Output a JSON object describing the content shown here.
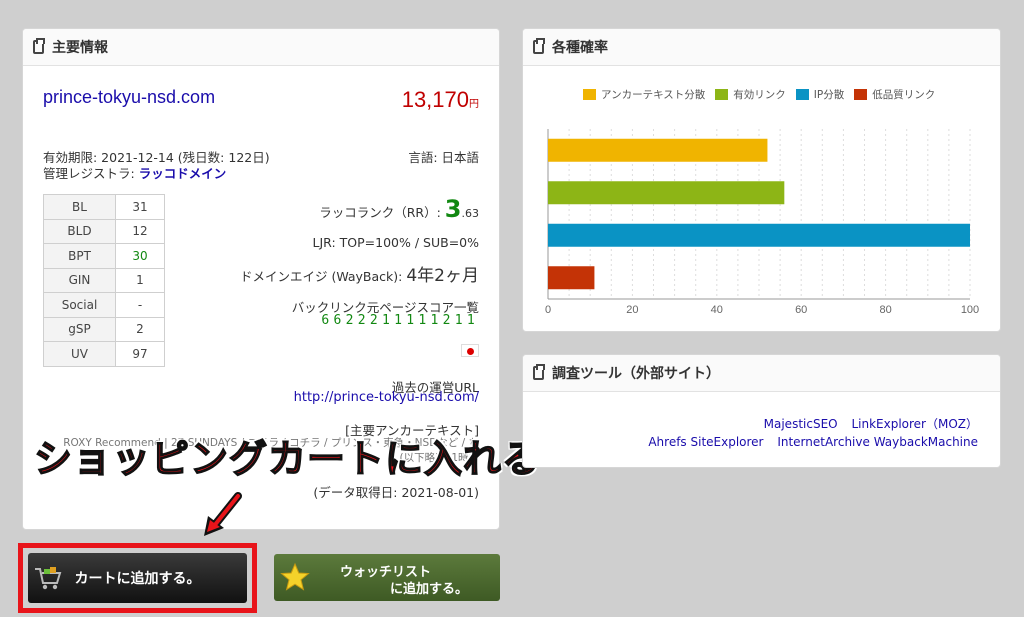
{
  "main": {
    "header": "主要情報",
    "domain": "prince-tokyu-nsd.com",
    "price": "13,170",
    "price_unit": "円",
    "expire": "有効期限: 2021-12-14 (残日数: 122日)",
    "registrar_label": "管理レジストラ: ",
    "registrar": "ラッコドメイン",
    "language": "言語: 日本語",
    "metrics": [
      {
        "key": "BL",
        "value": "31"
      },
      {
        "key": "BLD",
        "value": "12"
      },
      {
        "key": "BPT",
        "value": "30"
      },
      {
        "key": "GIN",
        "value": "1"
      },
      {
        "key": "Social",
        "value": "-"
      },
      {
        "key": "gSP",
        "value": "2"
      },
      {
        "key": "UV",
        "value": "97"
      }
    ],
    "rr_label": "ラッコランク（RR）:",
    "rr_big": "3",
    "rr_small": ".63",
    "ljr": "LJR: TOP=100% / SUB=0%",
    "age_label": "ドメインエイジ (WayBack):",
    "age_value": "4年2ヶ月",
    "backlink_title": "バックリンク元ページスコア一覧",
    "backlink_scores": "6622211111211",
    "past_label": "過去の運営URL",
    "past_url": "http://prince-tokyu-nsd.com/",
    "anchor_label": "[主要アンカーテキスト]",
    "anchor_line1": "ROXY Recommend | 27 SUNDAYS / コチラ / コチラ / プリンス・東急・NSDなど / ち",
    "anchor_line2": "…(以下略)  ×1時間",
    "fetch_date": "(データ取得日: 2021-08-01)"
  },
  "overlay": {
    "caption": "ショッピングカートに入れる"
  },
  "buttons": {
    "cart": "カートに追加する。",
    "watch_line1": "ウォッチリスト",
    "watch_line2": "に追加する。"
  },
  "prob": {
    "header": "各種確率"
  },
  "chart_data": {
    "type": "bar",
    "orientation": "horizontal",
    "series": [
      {
        "name": "アンカーテキスト分散",
        "value": 52,
        "color": "#f0b400"
      },
      {
        "name": "有効リンク",
        "value": 56,
        "color": "#8db516"
      },
      {
        "name": "IP分散",
        "value": 100,
        "color": "#0a93c4"
      },
      {
        "name": "低品質リンク",
        "value": 11,
        "color": "#c43306"
      }
    ],
    "xlim": [
      0,
      100
    ],
    "xticks": [
      "0",
      "20",
      "40",
      "60",
      "80",
      "100"
    ],
    "legend": "top",
    "grid": true
  },
  "tools": {
    "header": "調査ツール（外部サイト）",
    "links_row1": [
      "MajesticSEO",
      "LinkExplorer（MOZ）"
    ],
    "links_row2": [
      "Ahrefs SiteExplorer",
      "InternetArchive WaybackMachine"
    ]
  }
}
